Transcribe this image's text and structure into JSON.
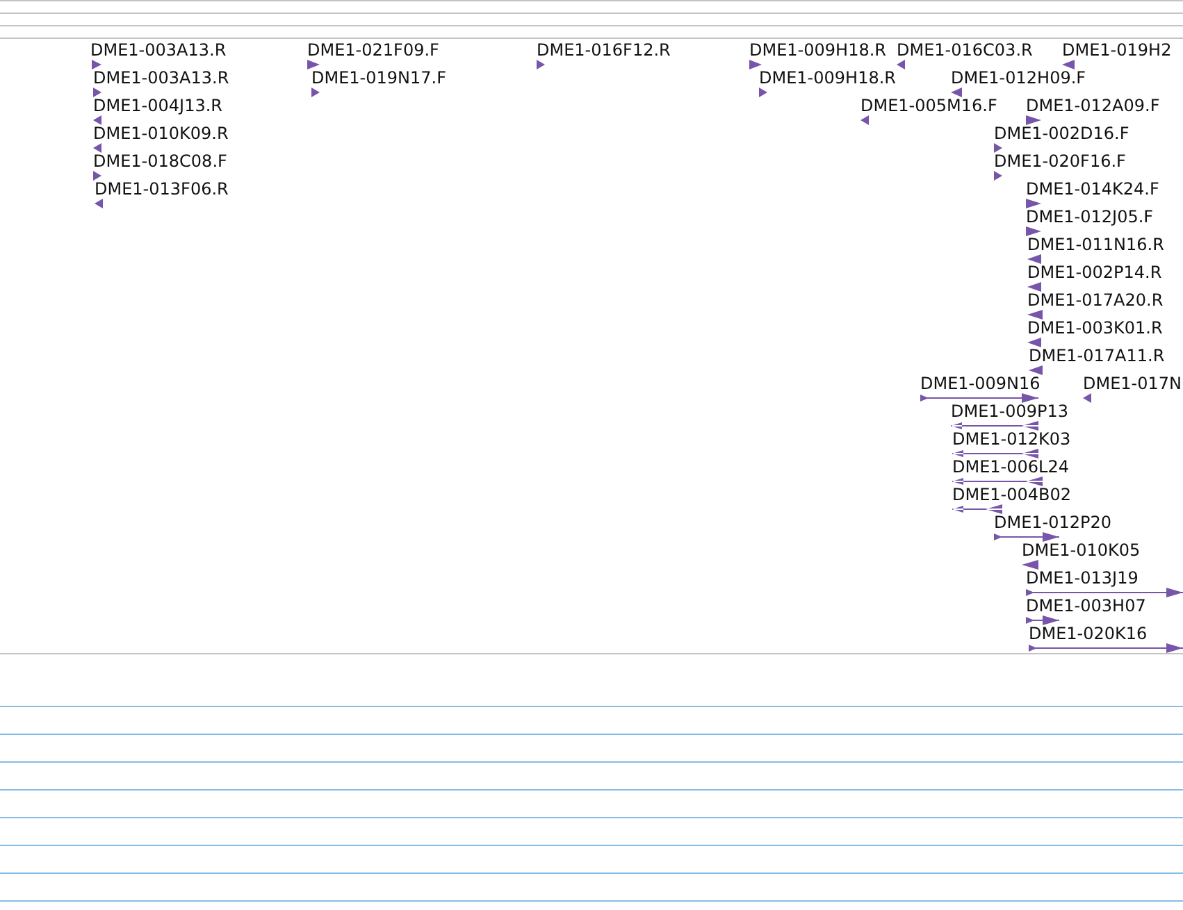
{
  "features": [
    {
      "label": "DME1-003A13.R",
      "kind": "forward"
    },
    {
      "label": "DME1-003A13.R",
      "kind": "forward"
    },
    {
      "label": "DME1-004J13.R",
      "kind": "reverse"
    },
    {
      "label": "DME1-010K09.R",
      "kind": "reverse"
    },
    {
      "label": "DME1-018C08.F",
      "kind": "forward"
    },
    {
      "label": "DME1-013F06.R",
      "kind": "reverse"
    },
    {
      "label": "DME1-021F09.F",
      "kind": "forward"
    },
    {
      "label": "DME1-019N17.F",
      "kind": "forward"
    },
    {
      "label": "DME1-016F12.R",
      "kind": "forward"
    },
    {
      "label": "DME1-009H18.R",
      "kind": "forward"
    },
    {
      "label": "DME1-009H18.R",
      "kind": "forward"
    },
    {
      "label": "DME1-016C03.R",
      "kind": "reverse"
    },
    {
      "label": "DME1-019H2",
      "kind": "reverse"
    },
    {
      "label": "DME1-012H09.F",
      "kind": "reverse"
    },
    {
      "label": "DME1-005M16.F",
      "kind": "reverse"
    },
    {
      "label": "DME1-012A09.F",
      "kind": "forward"
    },
    {
      "label": "DME1-002D16.F",
      "kind": "forward"
    },
    {
      "label": "DME1-020F16.F",
      "kind": "forward"
    },
    {
      "label": "DME1-014K24.F",
      "kind": "forward"
    },
    {
      "label": "DME1-012J05.F",
      "kind": "forward"
    },
    {
      "label": "DME1-011N16.R",
      "kind": "reverse"
    },
    {
      "label": "DME1-002P14.R",
      "kind": "reverse"
    },
    {
      "label": "DME1-017A20.R",
      "kind": "reverse"
    },
    {
      "label": "DME1-003K01.R",
      "kind": "reverse"
    },
    {
      "label": "DME1-017A11.R",
      "kind": "reverse"
    },
    {
      "label": "DME1-009N16",
      "kind": "forward"
    },
    {
      "label": "DME1-017N",
      "kind": "reverse"
    },
    {
      "label": "DME1-009P13",
      "kind": "reverse"
    },
    {
      "label": "DME1-012K03",
      "kind": "reverse"
    },
    {
      "label": "DME1-006L24",
      "kind": "reverse"
    },
    {
      "label": "DME1-004B02",
      "kind": "reverse"
    },
    {
      "label": "DME1-012P20",
      "kind": "forward"
    },
    {
      "label": "DME1-010K05",
      "kind": "reverse"
    },
    {
      "label": "DME1-013J19",
      "kind": "forward"
    },
    {
      "label": "DME1-003H07",
      "kind": "forward"
    },
    {
      "label": "DME1-020K16",
      "kind": "forward"
    }
  ]
}
